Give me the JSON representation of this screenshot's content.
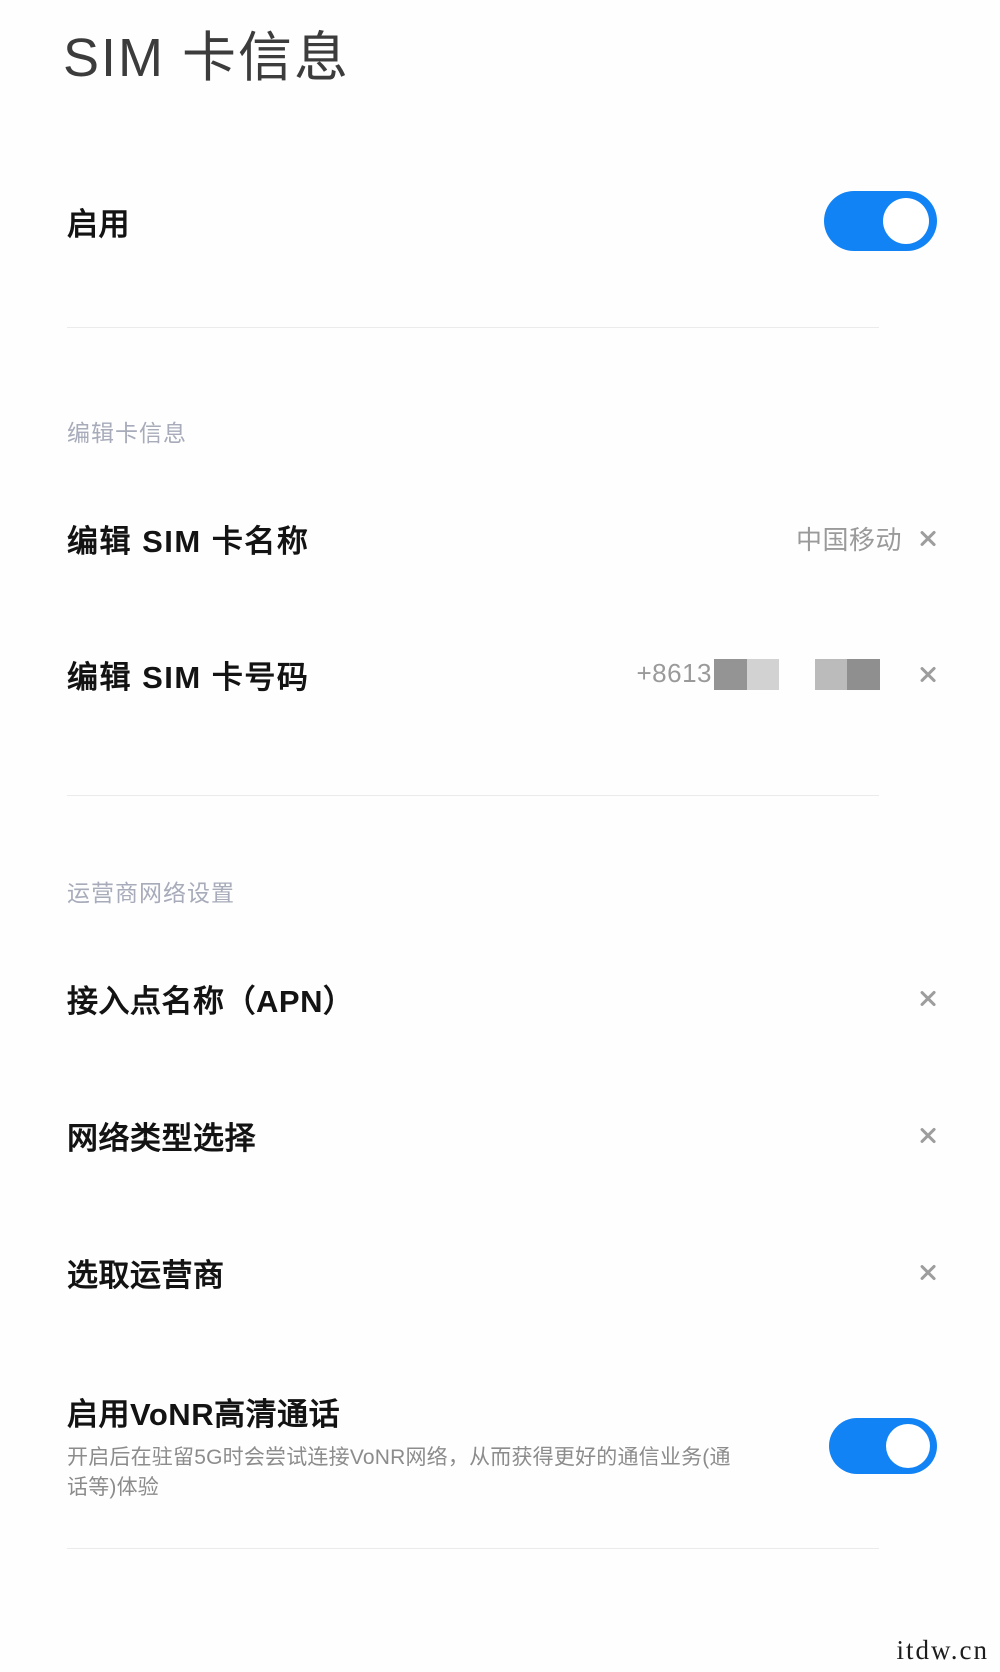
{
  "header": {
    "title": "SIM 卡信息"
  },
  "enable_row": {
    "label": "启用",
    "toggle_state": "on",
    "toggle_color": "#1283f5"
  },
  "sections": [
    {
      "label": "编辑卡信息",
      "rows": [
        {
          "title": "编辑 SIM 卡名称",
          "value": "中国移动",
          "accessory": "chevron-right-icon"
        },
        {
          "title": "编辑 SIM 卡号码",
          "value": "+8613",
          "value_redacted": true,
          "accessory": "chevron-right-icon"
        }
      ]
    },
    {
      "label": "运营商网络设置",
      "rows": [
        {
          "title": "接入点名称（APN）",
          "value": "",
          "accessory": "chevron-right-icon"
        },
        {
          "title": "网络类型选择",
          "value": "",
          "accessory": "chevron-right-icon"
        },
        {
          "title": "选取运营商",
          "value": "",
          "accessory": "chevron-right-icon"
        },
        {
          "title": "启用VoNR高清通话",
          "subtitle": "开启后在驻留5G时会尝试连接VoNR网络，从而获得更好的通信业务(通话等)体验",
          "accessory": "toggle",
          "toggle_state": "on"
        }
      ]
    }
  ],
  "redaction": {
    "block1_dark": "#949494",
    "block1_light": "#d2d2d2",
    "block2_light": "#bbbbbb",
    "block2_dark": "#8f8f8f"
  },
  "watermark": {
    "text": "itdw.cn"
  }
}
